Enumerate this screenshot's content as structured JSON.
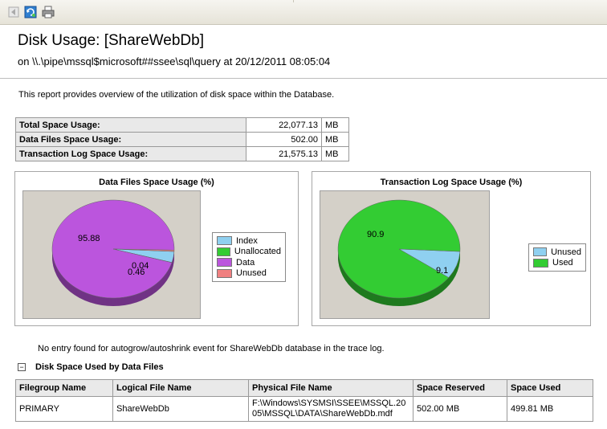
{
  "toolbar": {
    "icons": [
      "back-icon",
      "refresh-icon",
      "print-icon"
    ]
  },
  "report": {
    "title": "Disk Usage: [ShareWebDb]",
    "subtitle": "on \\\\.\\pipe\\mssql$microsoft##ssee\\sql\\query at 20/12/2011 08:05:04",
    "description": "This report provides overview of the utilization of disk space within the Database."
  },
  "summary": [
    {
      "label": "Total Space Usage:",
      "value": "22,077.13",
      "unit": "MB"
    },
    {
      "label": "Data Files Space Usage:",
      "value": "502.00",
      "unit": "MB"
    },
    {
      "label": "Transaction Log Space Usage:",
      "value": "21,575.13",
      "unit": "MB"
    }
  ],
  "chart_data": [
    {
      "type": "pie",
      "title": "Data Files Space Usage (%)",
      "categories": [
        "Index",
        "Unallocated",
        "Data",
        "Unused"
      ],
      "values": [
        3.62,
        0.04,
        95.88,
        0.46
      ],
      "data_labels": [
        "95.88",
        "0.04",
        "0.46"
      ],
      "colors": [
        "#8fd0f0",
        "#33cc33",
        "#bb55dd",
        "#f08080"
      ],
      "legend": "right"
    },
    {
      "type": "pie",
      "title": "Transaction Log Space Usage (%)",
      "categories": [
        "Unused",
        "Used"
      ],
      "values": [
        9.1,
        90.9
      ],
      "data_labels": [
        "90.9",
        "9.1"
      ],
      "colors": [
        "#8fd0f0",
        "#33cc33"
      ],
      "legend": "right"
    }
  ],
  "note": "No entry found for autogrow/autoshrink event for ShareWebDb database in the trace log.",
  "section": {
    "toggle": "−",
    "title": "Disk Space Used by Data Files"
  },
  "files_table": {
    "headers": [
      "Filegroup Name",
      "Logical File Name",
      "Physical File Name",
      "Space Reserved",
      "Space Used"
    ],
    "rows": [
      [
        "PRIMARY",
        "ShareWebDb",
        "F:\\Windows\\SYSMSI\\SSEE\\MSSQL.2005\\MSSQL\\DATA\\ShareWebDb.mdf",
        "502.00 MB",
        "499.81 MB"
      ]
    ]
  }
}
